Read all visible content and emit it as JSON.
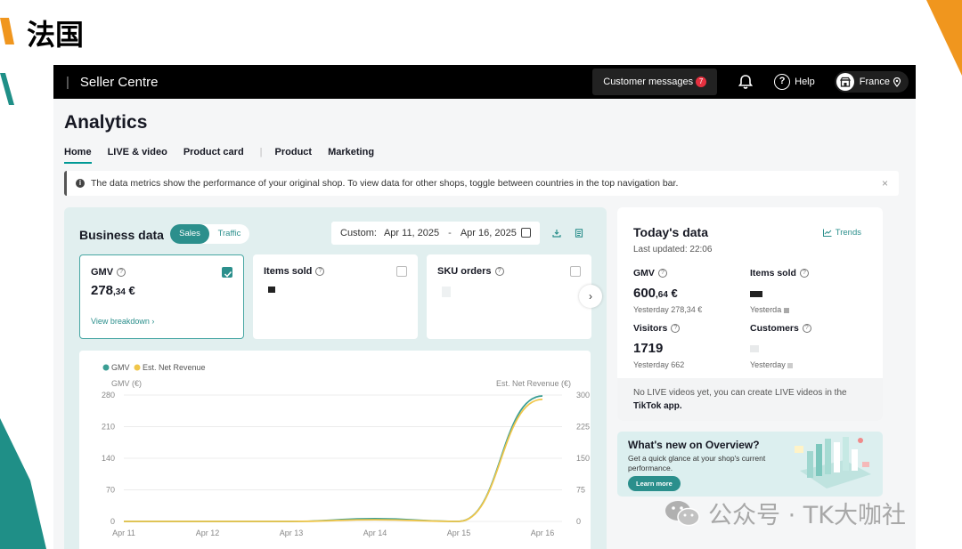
{
  "slide": {
    "title": "法国"
  },
  "topbar": {
    "brand": "Seller Centre",
    "brand_separator": "|",
    "customer_messages": "Customer messages",
    "messages_count": "7",
    "help": "Help",
    "country": "France"
  },
  "page": {
    "title": "Analytics",
    "tabs": [
      {
        "label": "Home",
        "active": true
      },
      {
        "label": "LIVE & video"
      },
      {
        "label": "Product card"
      },
      {
        "label": "Product"
      },
      {
        "label": "Marketing"
      }
    ],
    "notice": "The data metrics show the performance of your original shop. To view data for other shops, toggle between countries in the top navigation bar."
  },
  "business": {
    "title": "Business data",
    "toggle": {
      "on": "Sales",
      "off": "Traffic"
    },
    "date": {
      "prefix": "Custom:",
      "start": "Apr 11, 2025",
      "dash": "-",
      "end": "Apr 16, 2025"
    },
    "metrics": [
      {
        "label": "GMV",
        "value_int": "278",
        "value_dec": ",34",
        "currency": " €",
        "link": "View breakdown ›",
        "checked": true
      },
      {
        "label": "Items sold",
        "checked": false
      },
      {
        "label": "SKU orders",
        "checked": false
      }
    ],
    "next_glyph": "›"
  },
  "chart_data": {
    "type": "line",
    "x": [
      "Apr 11",
      "Apr 12",
      "Apr 13",
      "Apr 14",
      "Apr 15",
      "Apr 16"
    ],
    "series": [
      {
        "name": "GMV",
        "color": "#3b9e94",
        "axis": "left",
        "values": [
          0,
          0,
          0,
          6,
          0,
          278
        ]
      },
      {
        "name": "Est. Net Revenue",
        "color": "#f0c64a",
        "axis": "right",
        "values": [
          0,
          0,
          0,
          4,
          0,
          290
        ]
      }
    ],
    "ylabel_left": "GMV (€)",
    "ylabel_right": "Est. Net Revenue (€)",
    "left_ticks": [
      0,
      70,
      140,
      210,
      280
    ],
    "right_ticks": [
      0,
      75,
      150,
      225,
      300
    ],
    "ylim_left": [
      0,
      280
    ],
    "ylim_right": [
      0,
      300
    ],
    "grid": true,
    "legend": "top-left"
  },
  "today": {
    "title": "Today's data",
    "updated": "Last updated: 22:06",
    "trends": "Trends",
    "gmv": {
      "label": "GMV",
      "int": "600",
      "dec": ",64",
      "currency": " €",
      "yesterday": "Yesterday 278,34 €"
    },
    "items": {
      "label": "Items sold",
      "yesterday": "Yesterda"
    },
    "visitors": {
      "label": "Visitors",
      "value": "1719",
      "yesterday": "Yesterday 662"
    },
    "customers": {
      "label": "Customers",
      "yesterday": "Yesterday"
    },
    "live_note": "No LIVE videos yet, you can create LIVE videos in the",
    "live_app": "TikTok app."
  },
  "whatsnew": {
    "title": "What's new on Overview?",
    "desc": "Get a quick glance at your shop's current performance.",
    "button": "Learn more"
  },
  "watermark": {
    "text": "公众号 · TK大咖社"
  },
  "colors": {
    "accent": "#2b8f8c",
    "topbar": "#000000",
    "orange": "#f0961e",
    "teal": "#1f8f87"
  }
}
